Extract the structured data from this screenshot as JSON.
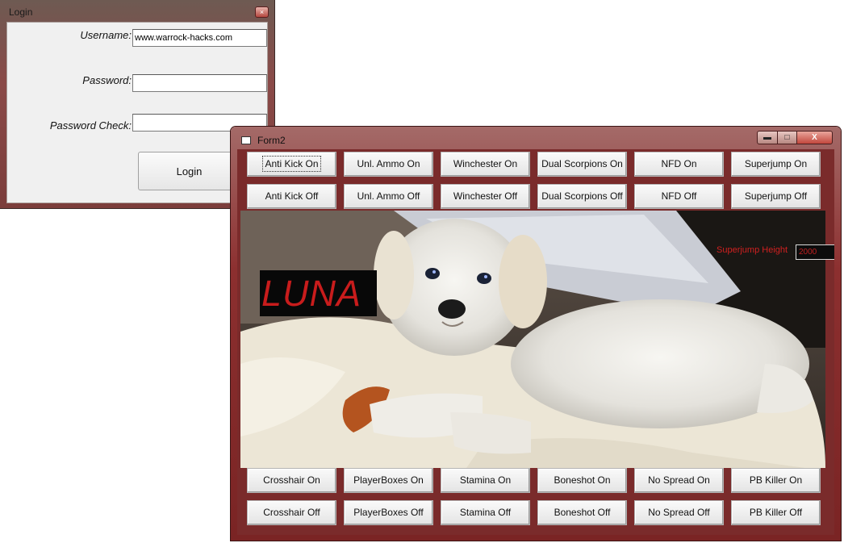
{
  "login": {
    "title": "Login",
    "close_glyph": "×",
    "username_label": "Username:",
    "username_value": "www.warrock-hacks.com",
    "password_label": "Password:",
    "password_value": "",
    "password_check_label": "Password Check:",
    "password_check_value": "",
    "login_button": "Login"
  },
  "form2": {
    "title": "Form2",
    "minimize_glyph": "▬",
    "maximize_glyph": "□",
    "close_glyph": "X",
    "top_row_on": [
      "Anti Kick On",
      "Unl. Ammo On",
      "Winchester On",
      "Dual Scorpions On",
      "NFD On",
      "Superjump On"
    ],
    "top_row_off": [
      "Anti Kick Off",
      "Unl. Ammo Off",
      "Winchester Off",
      "Dual Scorpions Off",
      "NFD Off",
      "Superjump Off"
    ],
    "bottom_row_on": [
      "Crosshair On",
      "PlayerBoxes On",
      "Stamina On",
      "Boneshot On",
      "No Spread On",
      "PB Killer On"
    ],
    "bottom_row_off": [
      "Crosshair Off",
      "PlayerBoxes Off",
      "Stamina Off",
      "Boneshot Off",
      "No Spread Off",
      "PB Killer Off"
    ],
    "superjump_height_label": "Superjump Height",
    "superjump_height_value": "2000",
    "luna_text": "LUNA",
    "focused_button": "Anti Kick On"
  },
  "colors": {
    "window_frame": "#8c2f2f",
    "accent_red": "#c81c1c"
  }
}
